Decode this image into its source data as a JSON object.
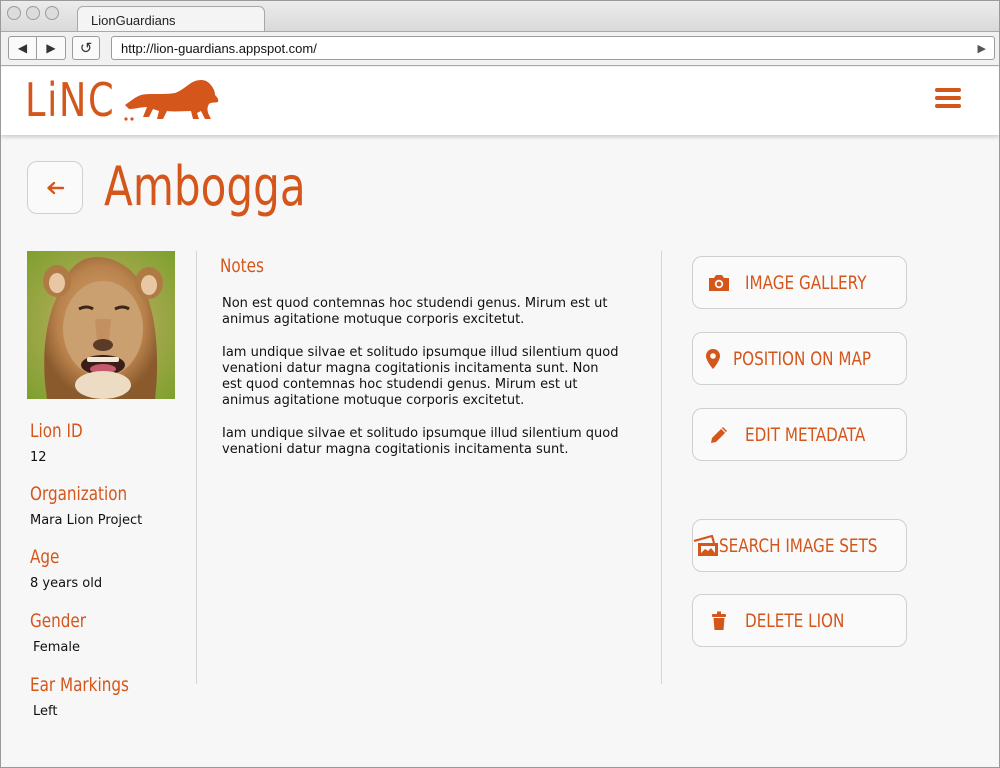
{
  "browser": {
    "tab_title": "LionGuardians",
    "url": "http://lion-guardians.appspot.com/",
    "back_label": "◀",
    "forward_label": "▶",
    "reload_label": "↺",
    "go_label": "▶"
  },
  "header": {
    "logo_text": "LiNC",
    "accent_color": "#d4561b"
  },
  "page": {
    "title": "Ambogga",
    "back_icon": "arrow-left-icon"
  },
  "attributes": [
    {
      "label": "Lion ID",
      "value": "12"
    },
    {
      "label": "Organization",
      "value": "Mara Lion Project"
    },
    {
      "label": "Age",
      "value": "8 years old"
    },
    {
      "label": "Gender",
      "value": "Female"
    },
    {
      "label": "Ear Markings",
      "value": "Left"
    }
  ],
  "notes": {
    "title": "Notes",
    "paragraphs": [
      "Non est quod contemnas hoc studendi genus. Mirum est ut animus agitatione motuque corporis excitetut.",
      "Iam undique silvae et solitudo ipsumque illud silentium quod venationi datur magna cogitationis incitamenta sunt. Non est quod contemnas hoc studendi genus. Mirum est ut animus agitatione motuque corporis excitetut.",
      "Iam undique silvae et solitudo ipsumque illud silentium quod venationi datur magna cogitationis incitamenta sunt."
    ]
  },
  "actions": [
    {
      "label": "IMAGE GALLERY",
      "icon": "camera-icon"
    },
    {
      "label": "POSITION ON MAP",
      "icon": "map-pin-icon"
    },
    {
      "label": "EDIT METADATA",
      "icon": "pencil-icon"
    },
    {
      "label": "SEARCH IMAGE SETS",
      "icon": "image-sets-icon"
    },
    {
      "label": "DELETE LION",
      "icon": "trash-icon"
    }
  ]
}
